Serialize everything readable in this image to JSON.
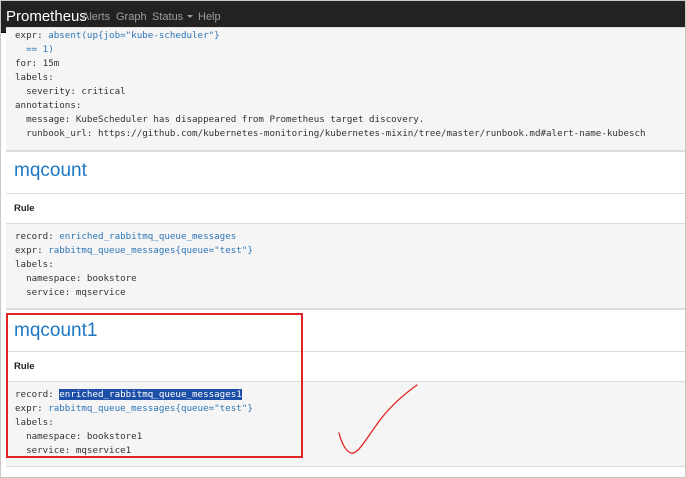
{
  "navbar": {
    "brand": "Prometheus",
    "links": [
      "Alerts",
      "Graph",
      "Status",
      "Help"
    ]
  },
  "top_block": {
    "expr_prefix": "expr: ",
    "expr_value": "absent(up{job=\"kube-scheduler\"}",
    "expr_cont": "  == 1)",
    "for_line": "for: 15m",
    "labels_line": "labels:",
    "severity_line": "  severity: critical",
    "annotations_line": "annotations:",
    "message_line": "  message: KubeScheduler has disappeared from Prometheus target discovery.",
    "runbook_line": "  runbook_url: https://github.com/kubernetes-monitoring/kubernetes-mixin/tree/master/runbook.md#alert-name-kubesch"
  },
  "groups": [
    {
      "title": "mqcount",
      "rule_header": "Rule",
      "record_key": "record: ",
      "record_value": "enriched_rabbitmq_queue_messages",
      "expr_key": "expr: ",
      "expr_value": "rabbitmq_queue_messages{queue=\"test\"}",
      "labels_line": "labels:",
      "namespace_line": "  namespace: bookstore",
      "service_line": "  service: mqservice"
    },
    {
      "title": "mqcount1",
      "rule_header": "Rule",
      "record_key": "record: ",
      "record_value": "enriched_rabbitmq_queue_messages1",
      "expr_key": "expr: ",
      "expr_value": "rabbitmq_queue_messages{queue=\"test\"}",
      "labels_line": "labels:",
      "namespace_line": "  namespace: bookstore1",
      "service_line": "  service: mqservice1"
    }
  ],
  "colors": {
    "navbar_bg": "#222222",
    "link_blue": "#1f77c3",
    "highlight": "#1e4fa8",
    "annotation_red": "#e02424"
  }
}
